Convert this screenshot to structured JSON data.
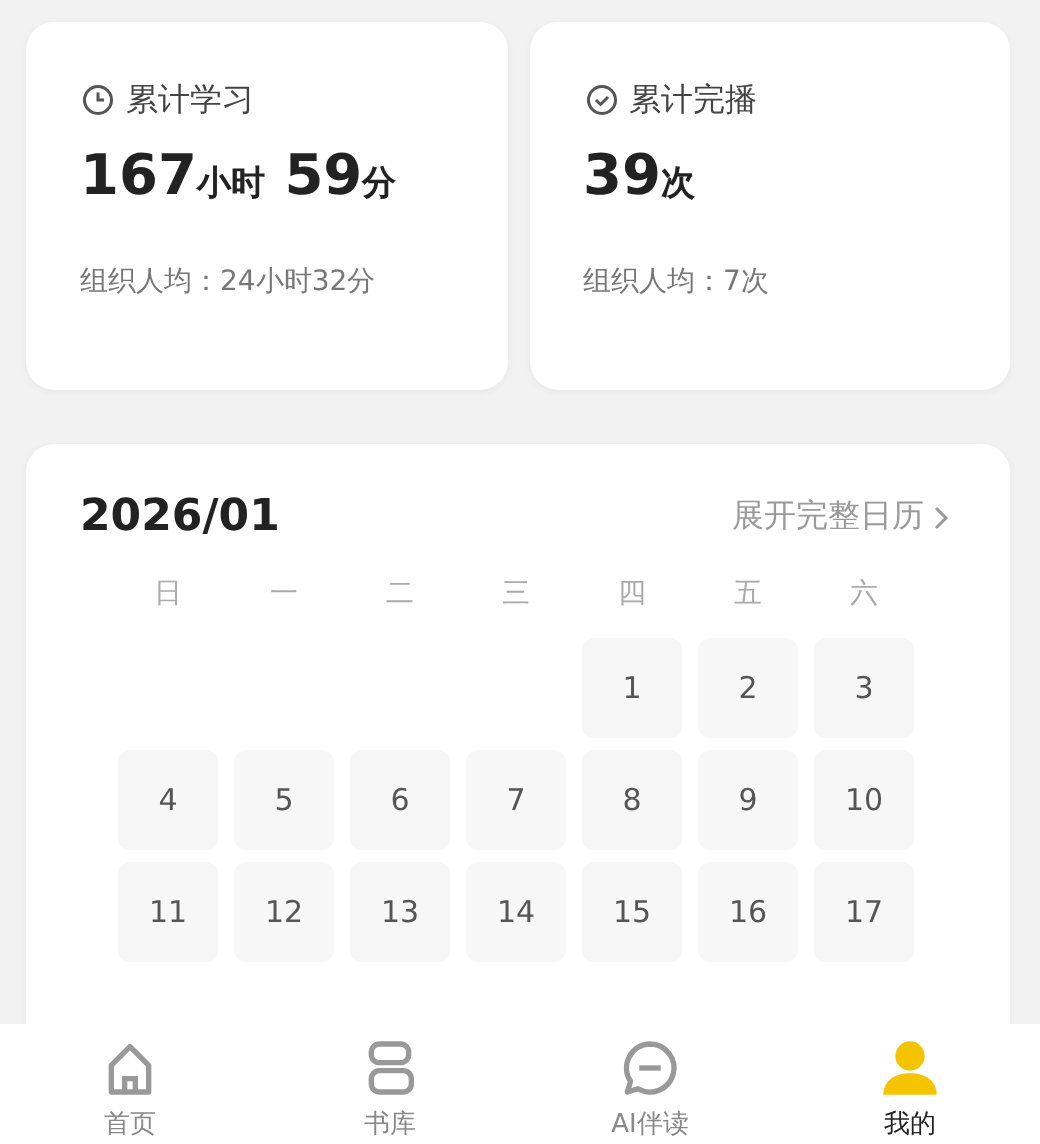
{
  "stats": [
    {
      "title": "累计学习",
      "value": [
        {
          "kind": "number",
          "text": "167"
        },
        {
          "kind": "unit",
          "text": "小时"
        },
        {
          "kind": "number",
          "text": " 59"
        },
        {
          "kind": "unit",
          "text": "分"
        }
      ],
      "average": "组织人均：24小时32分"
    },
    {
      "title": "累计完播",
      "value": [
        {
          "kind": "number",
          "text": "39"
        },
        {
          "kind": "unit",
          "text": "次"
        }
      ],
      "average": "组织人均：7次"
    }
  ],
  "calendar": {
    "month": "2026/01",
    "expand_link": "展开完整日历",
    "weekdays": [
      "日",
      "一",
      "二",
      "三",
      "四",
      "五",
      "六"
    ],
    "weeks": [
      [
        "1",
        "2",
        "3"
      ],
      [
        "4",
        "5",
        "6",
        "7",
        "8",
        "9",
        "10"
      ],
      [
        "11",
        "12",
        "13",
        "14",
        "15",
        "16",
        "17"
      ]
    ]
  },
  "nav": [
    {
      "label": "首页",
      "selected": false
    },
    {
      "label": "书库",
      "selected": false
    },
    {
      "label": "AI伴读",
      "selected": false
    },
    {
      "label": "我的",
      "selected": true
    }
  ]
}
